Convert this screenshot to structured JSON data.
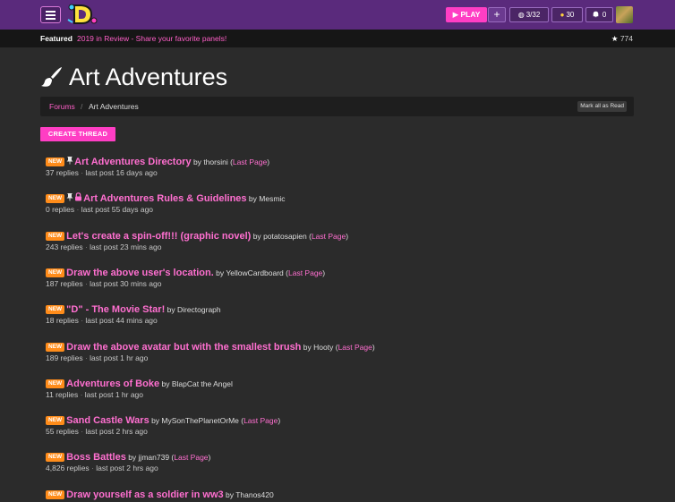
{
  "topbar": {
    "play_label": "PLAY",
    "plus_label": "+",
    "globe_stat": "3/32",
    "coin_stat": "30",
    "bell_stat": "0",
    "colors": {
      "accent": "#ff3ec4",
      "bar": "#5a2a7c"
    }
  },
  "featured": {
    "lead": "Featured",
    "link": "2019 in Review - Share your favorite panels!",
    "star_count": "774"
  },
  "page": {
    "title": "Art Adventures"
  },
  "breadcrumb": {
    "forums": "Forums",
    "separator": "/",
    "current": "Art Adventures",
    "mark_read": "Mark all as Read"
  },
  "create_thread": "CREATE THREAD",
  "new_label": "NEW",
  "by_label": "by",
  "threads": [
    {
      "title": "Art Adventures Directory",
      "author": "thorsini",
      "last_page": "Last Page",
      "replies": "37 replies",
      "last_post": "last post 16 days ago",
      "pinned": true,
      "locked": false
    },
    {
      "title": "Art Adventures Rules & Guidelines",
      "author": "Mesmic",
      "last_page": "",
      "replies": "0 replies",
      "last_post": "last post 55 days ago",
      "pinned": true,
      "locked": true
    },
    {
      "title": "Let's create a spin-off!!! (graphic novel)",
      "author": "potatosapien",
      "last_page": "Last Page",
      "replies": "243 replies",
      "last_post": "last post 23 mins ago",
      "pinned": false,
      "locked": false
    },
    {
      "title": "Draw the above user's location.",
      "author": "YellowCardboard",
      "last_page": "Last Page",
      "replies": "187 replies",
      "last_post": "last post 30 mins ago",
      "pinned": false,
      "locked": false
    },
    {
      "title": "\"D\" - The Movie Star!",
      "author": "Directograph",
      "last_page": "",
      "replies": "18 replies",
      "last_post": "last post 44 mins ago",
      "pinned": false,
      "locked": false
    },
    {
      "title": "Draw the above avatar but with the smallest brush",
      "author": "Hooty",
      "last_page": "Last Page",
      "replies": "189 replies",
      "last_post": "last post 1 hr ago",
      "pinned": false,
      "locked": false
    },
    {
      "title": "Adventures of Boke",
      "author": "BlapCat the Angel",
      "last_page": "",
      "replies": "11 replies",
      "last_post": "last post 1 hr ago",
      "pinned": false,
      "locked": false
    },
    {
      "title": "Sand Castle Wars",
      "author": "MySonThePlanetOrMe",
      "last_page": "Last Page",
      "replies": "55 replies",
      "last_post": "last post 2 hrs ago",
      "pinned": false,
      "locked": false
    },
    {
      "title": "Boss Battles",
      "author": "jjman739",
      "last_page": "Last Page",
      "replies": "4,826 replies",
      "last_post": "last post 2 hrs ago",
      "pinned": false,
      "locked": false
    },
    {
      "title": "Draw yourself as a soldier in ww3",
      "author": "Thanos420",
      "last_page": "",
      "replies": "",
      "last_post": "",
      "pinned": false,
      "locked": false
    }
  ]
}
